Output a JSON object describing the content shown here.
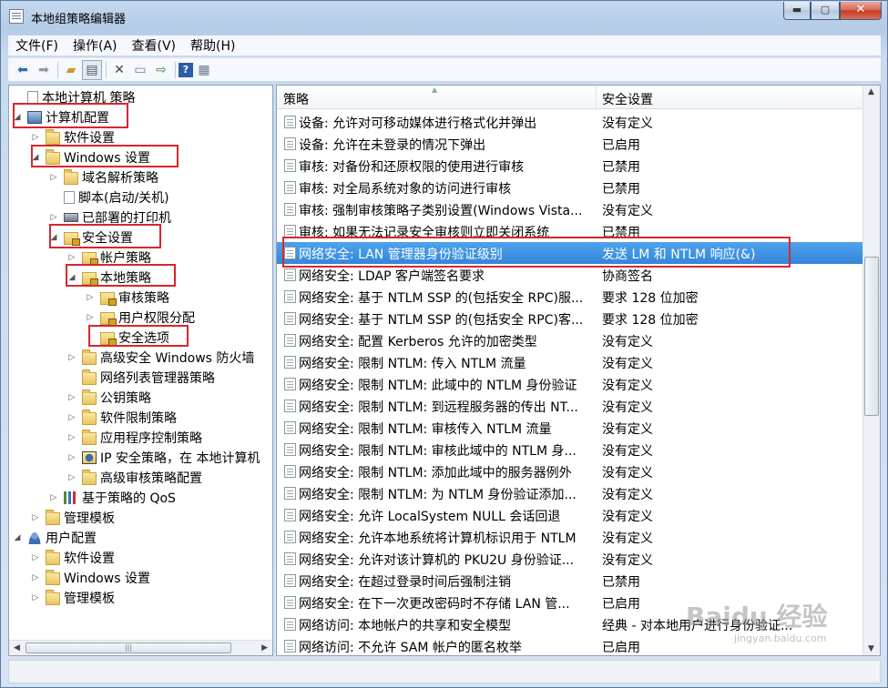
{
  "window": {
    "title": "本地组策略编辑器",
    "min": "▬",
    "max": "▢",
    "close": "✕"
  },
  "menu": [
    "文件(F)",
    "操作(A)",
    "查看(V)",
    "帮助(H)"
  ],
  "toolbar": [
    "back-icon",
    "forward-icon",
    "up-folder-icon",
    "show-tree-icon",
    "delete-icon",
    "properties-icon",
    "export-icon",
    "help-icon",
    "view-icon"
  ],
  "tree": [
    {
      "label": "本地计算机 策略",
      "icon": "doc",
      "twisty": "",
      "level": 0
    },
    {
      "label": "计算机配置",
      "icon": "comp",
      "twisty": "◢",
      "level": 0
    },
    {
      "label": "软件设置",
      "icon": "folder",
      "twisty": "▷",
      "level": 1
    },
    {
      "label": "Windows 设置",
      "icon": "folder",
      "twisty": "◢",
      "level": 1
    },
    {
      "label": "域名解析策略",
      "icon": "folder",
      "twisty": "▷",
      "level": 2
    },
    {
      "label": "脚本(启动/关机)",
      "icon": "script",
      "twisty": "",
      "level": 2
    },
    {
      "label": "已部署的打印机",
      "icon": "printer",
      "twisty": "▷",
      "level": 2
    },
    {
      "label": "安全设置",
      "icon": "lockf",
      "twisty": "◢",
      "level": 2
    },
    {
      "label": "帐户策略",
      "icon": "lockf",
      "twisty": "▷",
      "level": 3
    },
    {
      "label": "本地策略",
      "icon": "lockf",
      "twisty": "◢",
      "level": 3
    },
    {
      "label": "审核策略",
      "icon": "lockf",
      "twisty": "▷",
      "level": 4
    },
    {
      "label": "用户权限分配",
      "icon": "lockf",
      "twisty": "▷",
      "level": 4
    },
    {
      "label": "安全选项",
      "icon": "lockf",
      "twisty": "",
      "level": 4
    },
    {
      "label": "高级安全 Windows 防火墙",
      "icon": "folder",
      "twisty": "▷",
      "level": 3
    },
    {
      "label": "网络列表管理器策略",
      "icon": "folder",
      "twisty": "",
      "level": 3
    },
    {
      "label": "公钥策略",
      "icon": "folder",
      "twisty": "▷",
      "level": 3
    },
    {
      "label": "软件限制策略",
      "icon": "folder",
      "twisty": "▷",
      "level": 3
    },
    {
      "label": "应用程序控制策略",
      "icon": "folder",
      "twisty": "▷",
      "level": 3
    },
    {
      "label": "IP 安全策略，在 本地计算机",
      "icon": "shield",
      "twisty": "▷",
      "level": 3
    },
    {
      "label": "高级审核策略配置",
      "icon": "folder",
      "twisty": "▷",
      "level": 3
    },
    {
      "label": "基于策略的 QoS",
      "icon": "chart",
      "twisty": "▷",
      "level": 2
    },
    {
      "label": "管理模板",
      "icon": "folder",
      "twisty": "▷",
      "level": 1
    },
    {
      "label": "用户配置",
      "icon": "user",
      "twisty": "◢",
      "level": 0
    },
    {
      "label": "软件设置",
      "icon": "folder",
      "twisty": "▷",
      "level": 1
    },
    {
      "label": "Windows 设置",
      "icon": "folder",
      "twisty": "▷",
      "level": 1
    },
    {
      "label": "管理模板",
      "icon": "folder",
      "twisty": "▷",
      "level": 1
    }
  ],
  "columns": {
    "policy": "策略",
    "setting": "安全设置"
  },
  "policies": [
    {
      "name": "设备: 允许对可移动媒体进行格式化并弹出",
      "value": "没有定义"
    },
    {
      "name": "设备: 允许在未登录的情况下弹出",
      "value": "已启用"
    },
    {
      "name": "审核: 对备份和还原权限的使用进行审核",
      "value": "已禁用"
    },
    {
      "name": "审核: 对全局系统对象的访问进行审核",
      "value": "已禁用"
    },
    {
      "name": "审核: 强制审核策略子类别设置(Windows Vista...",
      "value": "没有定义"
    },
    {
      "name": "审核: 如果无法记录安全审核则立即关闭系统",
      "value": "已禁用"
    },
    {
      "name": "网络安全: LAN 管理器身份验证级别",
      "value": "发送 LM 和 NTLM 响应(&)"
    },
    {
      "name": "网络安全: LDAP 客户端签名要求",
      "value": "协商签名"
    },
    {
      "name": "网络安全: 基于 NTLM SSP 的(包括安全 RPC)服...",
      "value": "要求 128 位加密"
    },
    {
      "name": "网络安全: 基于 NTLM SSP 的(包括安全 RPC)客...",
      "value": "要求 128 位加密"
    },
    {
      "name": "网络安全: 配置 Kerberos 允许的加密类型",
      "value": "没有定义"
    },
    {
      "name": "网络安全: 限制 NTLM: 传入 NTLM 流量",
      "value": "没有定义"
    },
    {
      "name": "网络安全: 限制 NTLM: 此域中的 NTLM 身份验证",
      "value": "没有定义"
    },
    {
      "name": "网络安全: 限制 NTLM: 到远程服务器的传出 NT...",
      "value": "没有定义"
    },
    {
      "name": "网络安全: 限制 NTLM: 审核传入 NTLM 流量",
      "value": "没有定义"
    },
    {
      "name": "网络安全: 限制 NTLM: 审核此域中的 NTLM 身...",
      "value": "没有定义"
    },
    {
      "name": "网络安全: 限制 NTLM: 添加此域中的服务器例外",
      "value": "没有定义"
    },
    {
      "name": "网络安全: 限制 NTLM: 为 NTLM 身份验证添加...",
      "value": "没有定义"
    },
    {
      "name": "网络安全: 允许 LocalSystem NULL 会话回退",
      "value": "没有定义"
    },
    {
      "name": "网络安全: 允许本地系统将计算机标识用于 NTLM",
      "value": "没有定义"
    },
    {
      "name": "网络安全: 允许对该计算机的 PKU2U 身份验证...",
      "value": "没有定义"
    },
    {
      "name": "网络安全: 在超过登录时间后强制注销",
      "value": "已禁用"
    },
    {
      "name": "网络安全: 在下一次更改密码时不存储 LAN 管...",
      "value": "已启用"
    },
    {
      "name": "网络访问: 本地帐户的共享和安全模型",
      "value": "经典 - 对本地用户进行身份验证..."
    },
    {
      "name": "网络访问: 不允许 SAM 帐户的匿名枚举",
      "value": "已启用"
    }
  ],
  "selected_policy_index": 6,
  "watermark": {
    "text": "Baidu 经验",
    "sub": "jingyan.baidu.com"
  },
  "colors": {
    "selection": "#3387da",
    "highlight_box": "#d9262e"
  }
}
